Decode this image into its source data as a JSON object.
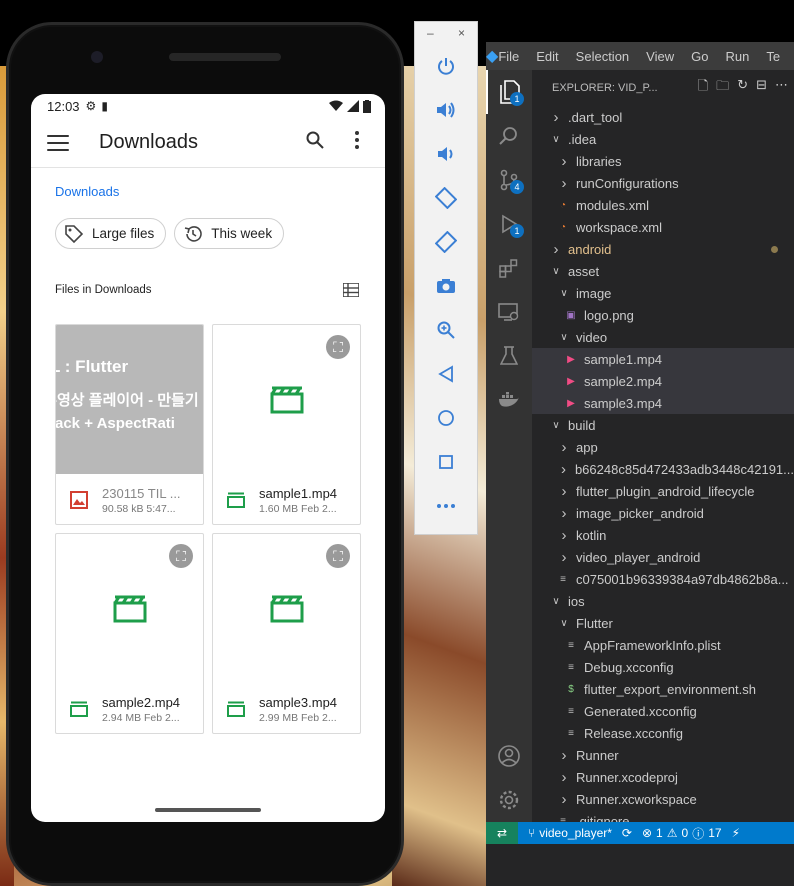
{
  "phone": {
    "status": {
      "time": "12:03",
      "icons": [
        "settings-icon",
        "sd-card-icon"
      ],
      "right_icons": [
        "wifi-icon",
        "signal-icon",
        "battery-icon"
      ]
    },
    "appbar": {
      "title": "Downloads",
      "menu_icon": "hamburger-icon",
      "search_icon": "search-icon",
      "more_icon": "more-vert-icon"
    },
    "breadcrumb": "Downloads",
    "chips": [
      {
        "label": "Large files",
        "icon": "tag-icon"
      },
      {
        "label": "This week",
        "icon": "history-icon"
      }
    ],
    "section": {
      "title": "Files in Downloads",
      "view_icon": "list-view-icon"
    },
    "thumb_text": {
      "line1": "L :  Flutter",
      "line2": "-영상 플레이어 - 만들기",
      "line3_a": "tack",
      "line3_b": "+",
      "line3_c": "AspectRati"
    },
    "files": [
      {
        "name": "230115 TIL ...",
        "sub": "90.58 kB 5:47...",
        "type": "image"
      },
      {
        "name": "sample1.mp4",
        "sub": "1.60 MB Feb 2...",
        "type": "video"
      },
      {
        "name": "sample2.mp4",
        "sub": "2.94 MB Feb 2...",
        "type": "video"
      },
      {
        "name": "sample3.mp4",
        "sub": "2.99 MB Feb 2...",
        "type": "video"
      }
    ]
  },
  "emulator": {
    "window_controls": {
      "minimize": "–",
      "close": "×"
    },
    "buttons": [
      "power-icon",
      "volume-up-icon",
      "volume-down-icon",
      "rotate-left-icon",
      "rotate-right-icon",
      "camera-icon",
      "zoom-icon",
      "back-icon",
      "home-icon",
      "overview-icon",
      "more-icon"
    ]
  },
  "vscode": {
    "menu": [
      "File",
      "Edit",
      "Selection",
      "View",
      "Go",
      "Run",
      "Te"
    ],
    "explorer_title": "EXPLORER: VID_P...",
    "activity_badges": {
      "explorer": "1",
      "scm": "4",
      "debug": "1"
    },
    "tree": [
      {
        "label": ".dart_tool",
        "indent": 1,
        "kind": "folder",
        "open": false
      },
      {
        "label": ".idea",
        "indent": 1,
        "kind": "folder",
        "open": true
      },
      {
        "label": "libraries",
        "indent": 2,
        "kind": "folder",
        "open": false
      },
      {
        "label": "runConfigurations",
        "indent": 2,
        "kind": "folder",
        "open": false
      },
      {
        "label": "modules.xml",
        "indent": 2,
        "kind": "rss"
      },
      {
        "label": "workspace.xml",
        "indent": 2,
        "kind": "rss"
      },
      {
        "label": "android",
        "indent": 1,
        "kind": "folder",
        "open": false,
        "modified": true
      },
      {
        "label": "asset",
        "indent": 1,
        "kind": "folder",
        "open": true
      },
      {
        "label": "image",
        "indent": 2,
        "kind": "folder",
        "open": true
      },
      {
        "label": "logo.png",
        "indent": 3,
        "kind": "image"
      },
      {
        "label": "video",
        "indent": 2,
        "kind": "folder",
        "open": true
      },
      {
        "label": "sample1.mp4",
        "indent": 3,
        "kind": "video",
        "selected": true
      },
      {
        "label": "sample2.mp4",
        "indent": 3,
        "kind": "video",
        "selected": true
      },
      {
        "label": "sample3.mp4",
        "indent": 3,
        "kind": "video",
        "selected": true
      },
      {
        "label": "build",
        "indent": 1,
        "kind": "folder",
        "open": true
      },
      {
        "label": "app",
        "indent": 2,
        "kind": "folder",
        "open": false
      },
      {
        "label": "b66248c85d472433adb3448c42191...",
        "indent": 2,
        "kind": "folder",
        "open": false
      },
      {
        "label": "flutter_plugin_android_lifecycle",
        "indent": 2,
        "kind": "folder",
        "open": false
      },
      {
        "label": "image_picker_android",
        "indent": 2,
        "kind": "folder",
        "open": false
      },
      {
        "label": "kotlin",
        "indent": 2,
        "kind": "folder",
        "open": false
      },
      {
        "label": "video_player_android",
        "indent": 2,
        "kind": "folder",
        "open": false
      },
      {
        "label": "c075001b96339384a97db4862b8a...",
        "indent": 2,
        "kind": "file"
      },
      {
        "label": "ios",
        "indent": 1,
        "kind": "folder",
        "open": true
      },
      {
        "label": "Flutter",
        "indent": 2,
        "kind": "folder",
        "open": true
      },
      {
        "label": "AppFrameworkInfo.plist",
        "indent": 3,
        "kind": "file"
      },
      {
        "label": "Debug.xcconfig",
        "indent": 3,
        "kind": "file"
      },
      {
        "label": "flutter_export_environment.sh",
        "indent": 3,
        "kind": "shell"
      },
      {
        "label": "Generated.xcconfig",
        "indent": 3,
        "kind": "file"
      },
      {
        "label": "Release.xcconfig",
        "indent": 3,
        "kind": "file"
      },
      {
        "label": "Runner",
        "indent": 2,
        "kind": "folder",
        "open": false
      },
      {
        "label": "Runner.xcodeproj",
        "indent": 2,
        "kind": "folder",
        "open": false
      },
      {
        "label": "Runner.xcworkspace",
        "indent": 2,
        "kind": "folder",
        "open": false
      },
      {
        "label": ".gitignore",
        "indent": 2,
        "kind": "file"
      }
    ],
    "statusbar": {
      "branch": "video_player*",
      "errors": "1",
      "warnings": "0",
      "info": "17"
    }
  }
}
